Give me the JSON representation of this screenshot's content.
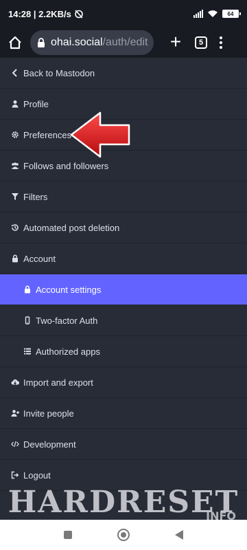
{
  "status_bar": {
    "left_text": "14:28 | 2.2KB/s",
    "battery": "64"
  },
  "browser": {
    "url_host": "ohai.social",
    "url_path": "/auth/edit",
    "tab_count": "5"
  },
  "nav": {
    "items": [
      {
        "label": "Back to Mastodon",
        "icon": "chevron-left-icon"
      },
      {
        "label": "Profile",
        "icon": "user-icon"
      },
      {
        "label": "Preferences",
        "icon": "gear-icon"
      },
      {
        "label": "Follows and followers",
        "icon": "users-icon"
      },
      {
        "label": "Filters",
        "icon": "filter-icon"
      },
      {
        "label": "Automated post deletion",
        "icon": "history-icon"
      },
      {
        "label": "Account",
        "icon": "lock-icon"
      },
      {
        "label": "Account settings",
        "icon": "lock-icon",
        "active": true
      },
      {
        "label": "Two-factor Auth",
        "icon": "mobile-icon"
      },
      {
        "label": "Authorized apps",
        "icon": "list-icon"
      },
      {
        "label": "Import and export",
        "icon": "cloud-download-icon"
      },
      {
        "label": "Invite people",
        "icon": "user-plus-icon"
      },
      {
        "label": "Development",
        "icon": "code-icon"
      },
      {
        "label": "Logout",
        "icon": "sign-out-icon"
      }
    ]
  },
  "watermark": {
    "main": "HARDRESET",
    "sub": "INFO"
  },
  "colors": {
    "active": "#6364ff",
    "background": "#282c37",
    "arrow": "#e0161b"
  }
}
